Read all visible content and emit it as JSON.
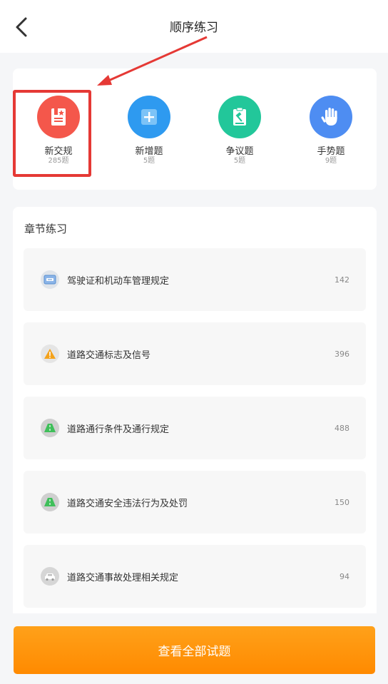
{
  "header": {
    "title": "顺序练习",
    "back_icon": "chevron-left-icon"
  },
  "categories": [
    {
      "name": "新交规",
      "count": "285题",
      "icon": "book-star-icon",
      "color": "#f4574b"
    },
    {
      "name": "新增题",
      "count": "5题",
      "icon": "plus-box-icon",
      "color": "#2e9af0"
    },
    {
      "name": "争议题",
      "count": "5题",
      "icon": "gavel-clipboard-icon",
      "color": "#22c79a"
    },
    {
      "name": "手势题",
      "count": "9题",
      "icon": "hand-icon",
      "color": "#4e8df2"
    }
  ],
  "chapters_section": {
    "title": "章节练习",
    "items": [
      {
        "label": "驾驶证和机动车管理规定",
        "count": "142",
        "icon": "license-card-icon"
      },
      {
        "label": "道路交通标志及信号",
        "count": "396",
        "icon": "warning-sign-icon"
      },
      {
        "label": "道路通行条件及通行规定",
        "count": "488",
        "icon": "road-icon"
      },
      {
        "label": "道路交通安全违法行为及处罚",
        "count": "150",
        "icon": "road-icon"
      },
      {
        "label": "道路交通事故处理相关规定",
        "count": "94",
        "icon": "car-accident-icon"
      }
    ]
  },
  "footer": {
    "button_label": "查看全部试题"
  },
  "colors": {
    "accent_orange": "#ff9000",
    "annotation_red": "#e53935"
  }
}
